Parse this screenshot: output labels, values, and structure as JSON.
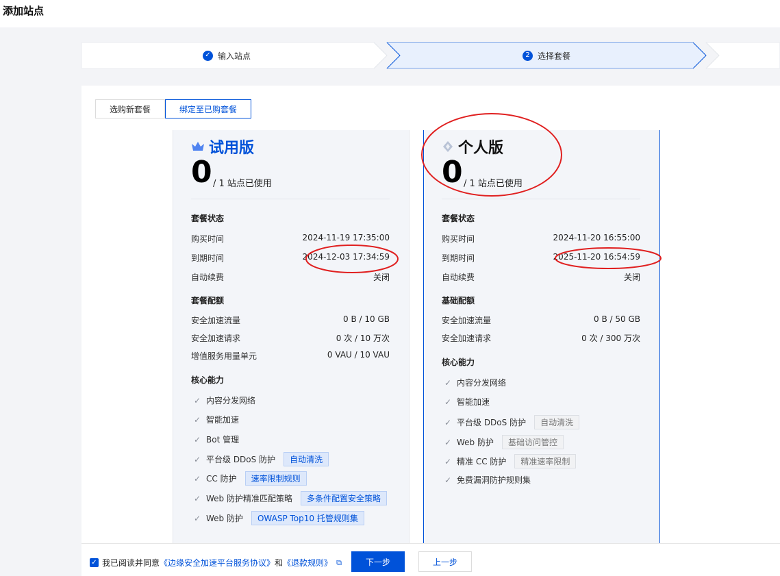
{
  "page": {
    "title": "添加站点"
  },
  "steps": [
    {
      "label": "输入站点",
      "state": "done"
    },
    {
      "label": "选择套餐",
      "index": "2",
      "state": "active"
    }
  ],
  "tabs": [
    {
      "label": "选购新套餐",
      "active": false
    },
    {
      "label": "绑定至已购套餐",
      "active": true
    }
  ],
  "plans": [
    {
      "name": "试用版",
      "icon": "crown-icon",
      "used": "0",
      "usage_text": "/ 1 站点已使用",
      "status_title": "套餐状态",
      "status": [
        {
          "label": "购买时间",
          "value": "2024-11-19 17:35:00"
        },
        {
          "label": "到期时间",
          "value": "2024-12-03 17:34:59"
        },
        {
          "label": "自动续费",
          "value": "关闭"
        }
      ],
      "quota_title": "套餐配额",
      "quota": [
        {
          "label": "安全加速流量",
          "value": "0 B / 10 GB"
        },
        {
          "label": "安全加速请求",
          "value": "0 次 / 10 万次"
        },
        {
          "label": "增值服务用量单元",
          "value": "0 VAU / 10 VAU"
        }
      ],
      "features_title": "核心能力",
      "features": [
        {
          "label": "内容分发网络",
          "tag": ""
        },
        {
          "label": "智能加速",
          "tag": ""
        },
        {
          "label": "Bot 管理",
          "tag": ""
        },
        {
          "label": "平台级 DDoS 防护",
          "tag": "自动清洗"
        },
        {
          "label": "CC 防护",
          "tag": "速率限制规则"
        },
        {
          "label": "Web 防护精准匹配策略",
          "tag": "多条件配置安全策略"
        },
        {
          "label": "Web 防护",
          "tag": "OWASP Top10 托管规则集"
        }
      ]
    },
    {
      "name": "个人版",
      "icon": "diamond-icon",
      "used": "0",
      "usage_text": "/ 1 站点已使用",
      "status_title": "套餐状态",
      "status": [
        {
          "label": "购买时间",
          "value": "2024-11-20 16:55:00"
        },
        {
          "label": "到期时间",
          "value": "2025-11-20 16:54:59"
        },
        {
          "label": "自动续费",
          "value": "关闭"
        }
      ],
      "quota_title": "基础配额",
      "quota": [
        {
          "label": "安全加速流量",
          "value": "0 B / 50 GB"
        },
        {
          "label": "安全加速请求",
          "value": "0 次 / 300 万次"
        }
      ],
      "features_title": "核心能力",
      "features": [
        {
          "label": "内容分发网络",
          "tag": ""
        },
        {
          "label": "智能加速",
          "tag": ""
        },
        {
          "label": "平台级 DDoS 防护",
          "tag": "自动清洗"
        },
        {
          "label": "Web 防护",
          "tag": "基础访问管控"
        },
        {
          "label": "精准 CC 防护",
          "tag": "精准速率限制"
        },
        {
          "label": "免费漏洞防护规则集",
          "tag": ""
        }
      ]
    }
  ],
  "footer": {
    "agree_prefix": "我已阅读并同意",
    "agreement_link": "《边缘安全加速平台服务协议》",
    "and_text": "和",
    "refund_link": "《退款规则》",
    "next_label": "下一步",
    "prev_label": "上一步"
  },
  "colors": {
    "primary": "#0052d9",
    "annotation": "#e02020"
  }
}
